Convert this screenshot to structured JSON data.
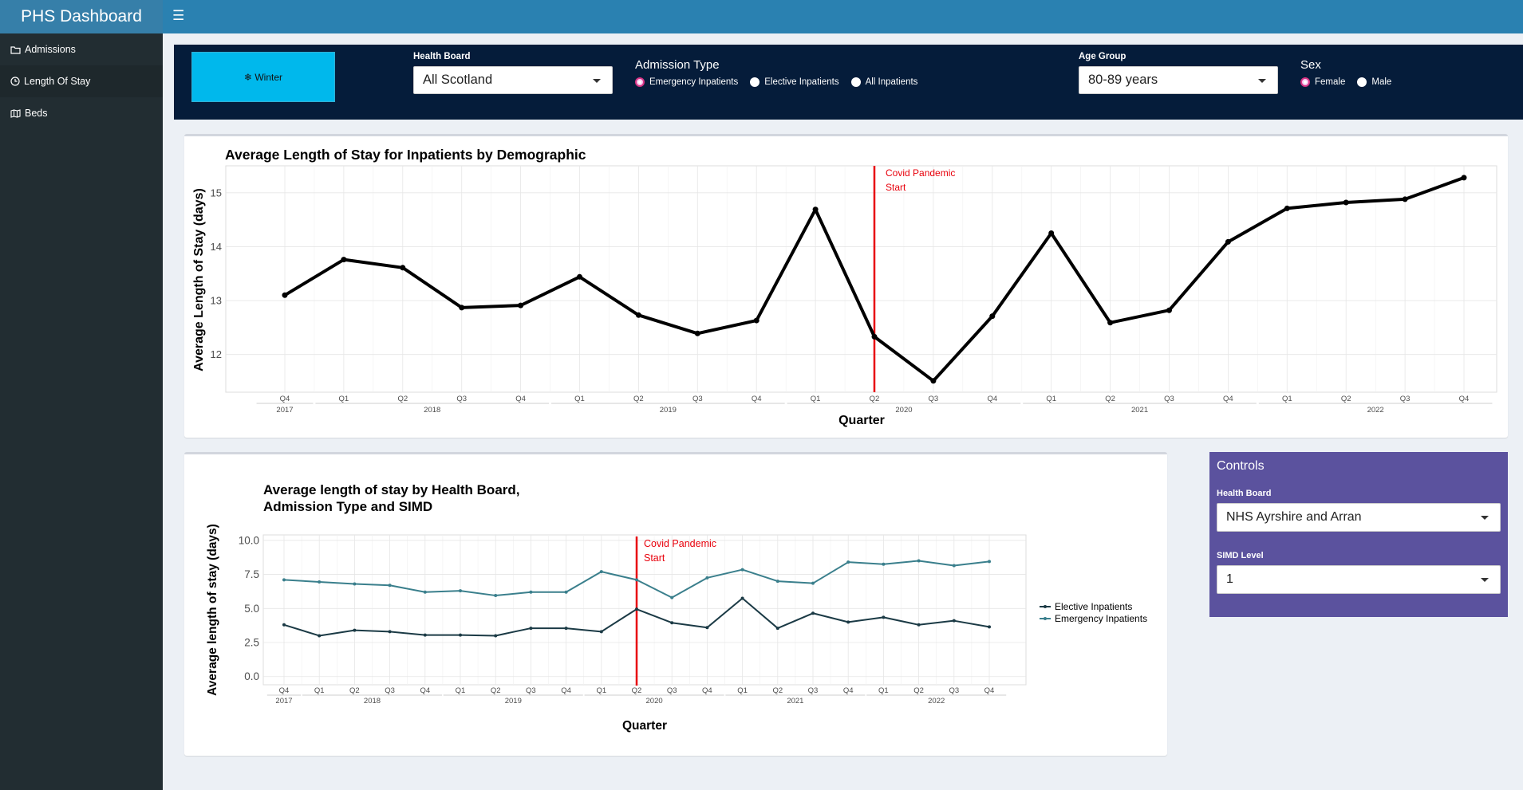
{
  "app": {
    "title": "PHS Dashboard"
  },
  "sidebar": {
    "items": [
      {
        "label": "Admissions",
        "icon": "folder-icon"
      },
      {
        "label": "Length Of Stay",
        "icon": "clock-icon"
      },
      {
        "label": "Beds",
        "icon": "map-icon"
      }
    ]
  },
  "filters": {
    "winter_button": "❄ Winter",
    "health_board": {
      "label": "Health Board",
      "value": "All Scotland"
    },
    "admission_type": {
      "label": "Admission Type",
      "options": [
        "Emergency Inpatients",
        "Elective Inpatients",
        "All Inpatients"
      ],
      "selected": "Emergency Inpatients"
    },
    "age_group": {
      "label": "Age Group",
      "value": "80-89 years"
    },
    "sex": {
      "label": "Sex",
      "options": [
        "Female",
        "Male"
      ],
      "selected": "Female"
    }
  },
  "controls": {
    "title": "Controls",
    "health_board": {
      "label": "Health Board",
      "value": "NHS Ayrshire and Arran"
    },
    "simd": {
      "label": "SIMD Level",
      "value": "1"
    }
  },
  "colors": {
    "header": "#2a81b1",
    "filter_bar": "#051c3a",
    "winter": "#00b8ec",
    "controls": "#5b529e",
    "elective": "#1b3a45",
    "emergency": "#3a7f8c",
    "covid_line": "#e8000b"
  },
  "chart_data": [
    {
      "type": "line",
      "title": "Average Length of Stay for Inpatients by Demographic",
      "xlabel": "Quarter",
      "ylabel": "Average Length of Stay (days)",
      "quarters": [
        "Q4",
        "Q1",
        "Q2",
        "Q3",
        "Q4",
        "Q1",
        "Q2",
        "Q3",
        "Q4",
        "Q1",
        "Q2",
        "Q3",
        "Q4",
        "Q1",
        "Q2",
        "Q3",
        "Q4",
        "Q1",
        "Q2",
        "Q3",
        "Q4"
      ],
      "years": [
        {
          "label": "2017",
          "from": 0,
          "to": 0
        },
        {
          "label": "2018",
          "from": 1,
          "to": 4
        },
        {
          "label": "2019",
          "from": 5,
          "to": 8
        },
        {
          "label": "2020",
          "from": 9,
          "to": 12
        },
        {
          "label": "2021",
          "from": 13,
          "to": 16
        },
        {
          "label": "2022",
          "from": 17,
          "to": 20
        }
      ],
      "yticks": [
        12,
        13,
        14,
        15
      ],
      "ylim": [
        11.3,
        15.5
      ],
      "series": [
        {
          "values": [
            13.1,
            13.76,
            13.61,
            12.87,
            12.91,
            13.44,
            12.73,
            12.39,
            12.63,
            14.69,
            12.33,
            11.51,
            12.71,
            14.25,
            12.59,
            12.82,
            14.09,
            14.71,
            14.82,
            14.88,
            15.28
          ]
        }
      ],
      "annotation": {
        "text": [
          "Covid Pandemic",
          "Start"
        ],
        "at_index": 10
      },
      "grid": true
    },
    {
      "type": "line",
      "title": [
        "Average length of stay by Health Board,",
        "Admission Type and SIMD"
      ],
      "xlabel": "Quarter",
      "ylabel": "Average length of stay (days)",
      "quarters": [
        "Q4",
        "Q1",
        "Q2",
        "Q3",
        "Q4",
        "Q1",
        "Q2",
        "Q3",
        "Q4",
        "Q1",
        "Q2",
        "Q3",
        "Q4",
        "Q1",
        "Q2",
        "Q3",
        "Q4",
        "Q1",
        "Q2",
        "Q3",
        "Q4"
      ],
      "years": [
        {
          "label": "2017",
          "from": 0,
          "to": 0
        },
        {
          "label": "2018",
          "from": 1,
          "to": 4
        },
        {
          "label": "2019",
          "from": 5,
          "to": 8
        },
        {
          "label": "2020",
          "from": 9,
          "to": 12
        },
        {
          "label": "2021",
          "from": 13,
          "to": 16
        },
        {
          "label": "2022",
          "from": 17,
          "to": 20
        }
      ],
      "yticks": [
        "0.0",
        "2.5",
        "5.0",
        "7.5",
        "10.0"
      ],
      "ylim": [
        -0.6,
        10.4
      ],
      "series": [
        {
          "name": "Elective Inpatients",
          "color": "#1b3a45",
          "values": [
            3.8,
            3.0,
            3.4,
            3.3,
            3.05,
            3.05,
            3.0,
            3.55,
            3.55,
            3.3,
            4.95,
            3.95,
            3.6,
            5.75,
            3.55,
            4.65,
            4.0,
            4.35,
            3.8,
            4.1,
            3.65
          ]
        },
        {
          "name": "Emergency Inpatients",
          "color": "#3a7f8c",
          "values": [
            7.1,
            6.95,
            6.8,
            6.7,
            6.2,
            6.3,
            5.95,
            6.2,
            6.2,
            7.7,
            7.1,
            5.8,
            7.25,
            7.85,
            7.0,
            6.85,
            8.4,
            8.25,
            8.5,
            8.15,
            8.45
          ]
        }
      ],
      "annotation": {
        "text": [
          "Covid Pandemic",
          "Start"
        ],
        "at_index": 10
      },
      "grid": true,
      "legend": "right"
    }
  ]
}
